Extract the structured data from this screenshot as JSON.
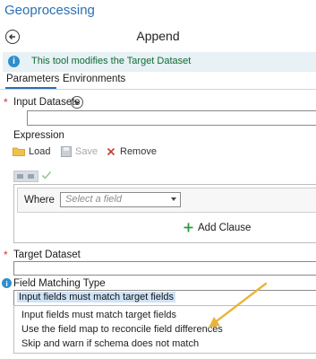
{
  "window": {
    "title": "Geoprocessing"
  },
  "tool": {
    "name": "Append",
    "info": "This tool modifies the Target Dataset"
  },
  "tabs": {
    "parameters": "Parameters",
    "environments": "Environments"
  },
  "input_datasets": {
    "label": "Input Datasets",
    "value": ""
  },
  "expression": {
    "label": "Expression",
    "load": "Load",
    "save": "Save",
    "remove": "Remove",
    "where_label": "Where",
    "field_placeholder": "Select a field",
    "add_clause": "Add Clause"
  },
  "target_dataset": {
    "label": "Target Dataset",
    "value": ""
  },
  "field_matching": {
    "label": "Field Matching Type",
    "selected": "Input fields must match target fields",
    "options": [
      "Input fields must match target fields",
      "Use the field map to reconcile field differences",
      "Skip and warn if schema does not match"
    ]
  },
  "colors": {
    "accent": "#2a6fb6",
    "info_text": "#0f6c2f",
    "required": "#c43a2f",
    "annotation_arrow": "#e8b53a"
  }
}
